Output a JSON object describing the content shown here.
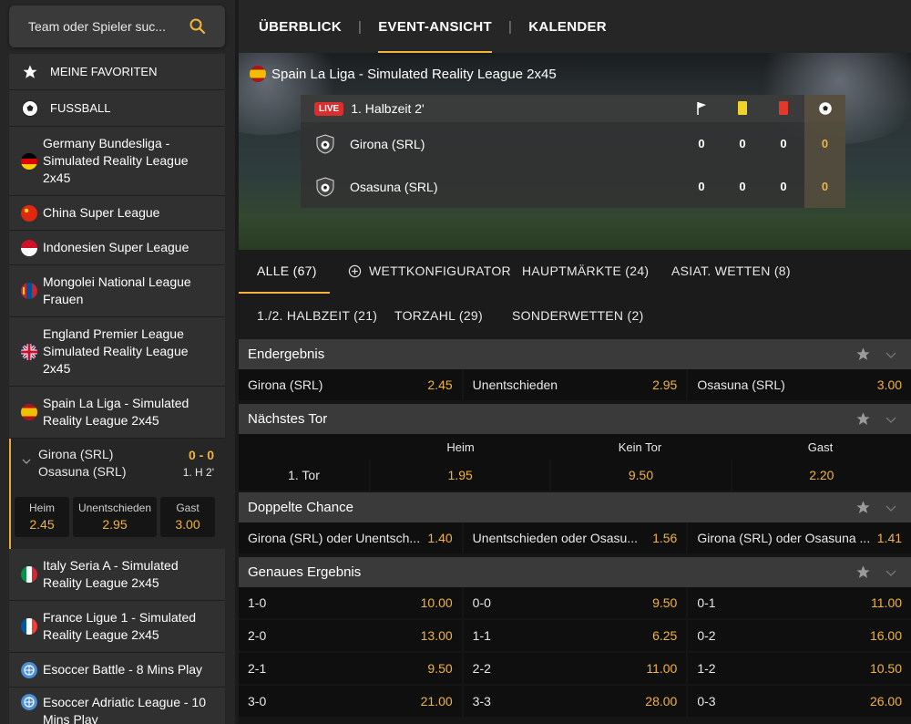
{
  "search": {
    "placeholder": "Team oder Spieler suc..."
  },
  "sidebar": {
    "favorites": "MEINE FAVORITEN",
    "sport": "FUSSBALL",
    "leagues": [
      {
        "name": "Germany Bundesliga - Simulated Reality League 2x45"
      },
      {
        "name": "China Super League"
      },
      {
        "name": "Indonesien Super League"
      },
      {
        "name": "Mongolei National League Frauen"
      },
      {
        "name": "England Premier League Simulated Reality League 2x45"
      },
      {
        "name": "Spain La Liga - Simulated Reality League 2x45"
      },
      {
        "name": "Italy Seria A - Simulated Reality League 2x45"
      },
      {
        "name": "France Ligue 1 - Simulated Reality League 2x45"
      },
      {
        "name": "Esoccer Battle - 8 Mins Play"
      },
      {
        "name": "Esoccer Adriatic League - 10 Mins Play"
      }
    ],
    "match": {
      "home": "Girona (SRL)",
      "away": "Osasuna (SRL)",
      "score": "0 - 0",
      "time": "1. H 2'",
      "odds": [
        {
          "label": "Heim",
          "value": "2.45"
        },
        {
          "label": "Unentschieden",
          "value": "2.95"
        },
        {
          "label": "Gast",
          "value": "3.00"
        }
      ]
    }
  },
  "tabs": {
    "overview": "ÜBERBLICK",
    "event": "EVENT-ANSICHT",
    "calendar": "KALENDER",
    "sep": "|"
  },
  "event": {
    "league": "Spain La Liga - Simulated Reality League 2x45",
    "live": "LIVE",
    "period": "1. Halbzeit 2'",
    "teams": [
      {
        "name": "Girona (SRL)",
        "corners": "0",
        "yellow": "0",
        "red": "0",
        "goals": "0"
      },
      {
        "name": "Osasuna (SRL)",
        "corners": "0",
        "yellow": "0",
        "red": "0",
        "goals": "0"
      }
    ]
  },
  "market_tabs": {
    "all": "ALLE (67)",
    "configurator": "WETTKONFIGURATOR",
    "main": "HAUPTMÄRKTE (24)",
    "asian": "ASIAT. WETTEN (8)",
    "half": "1./2. HALBZEIT (21)",
    "goals": "TORZAHL (29)",
    "special": "SONDERWETTEN (2)"
  },
  "markets": {
    "result": {
      "title": "Endergebnis",
      "odds": [
        {
          "label": "Girona (SRL)",
          "value": "2.45"
        },
        {
          "label": "Unentschieden",
          "value": "2.95"
        },
        {
          "label": "Osasuna (SRL)",
          "value": "3.00"
        }
      ]
    },
    "next_goal": {
      "title": "Nächstes Tor",
      "headers": [
        "Heim",
        "Kein Tor",
        "Gast"
      ],
      "row_label": "1. Tor",
      "values": [
        "1.95",
        "9.50",
        "2.20"
      ]
    },
    "double_chance": {
      "title": "Doppelte Chance",
      "odds": [
        {
          "label": "Girona (SRL) oder Unentsch...",
          "value": "1.40"
        },
        {
          "label": "Unentschieden oder Osasu...",
          "value": "1.56"
        },
        {
          "label": "Girona (SRL) oder Osasuna ...",
          "value": "1.41"
        }
      ]
    },
    "exact": {
      "title": "Genaues Ergebnis",
      "rows": [
        [
          {
            "label": "1-0",
            "value": "10.00"
          },
          {
            "label": "0-0",
            "value": "9.50"
          },
          {
            "label": "0-1",
            "value": "11.00"
          }
        ],
        [
          {
            "label": "2-0",
            "value": "13.00"
          },
          {
            "label": "1-1",
            "value": "6.25"
          },
          {
            "label": "0-2",
            "value": "16.00"
          }
        ],
        [
          {
            "label": "2-1",
            "value": "9.50"
          },
          {
            "label": "2-2",
            "value": "11.00"
          },
          {
            "label": "1-2",
            "value": "10.50"
          }
        ],
        [
          {
            "label": "3-0",
            "value": "21.00"
          },
          {
            "label": "3-3",
            "value": "28.00"
          },
          {
            "label": "0-3",
            "value": "26.00"
          }
        ]
      ]
    }
  }
}
